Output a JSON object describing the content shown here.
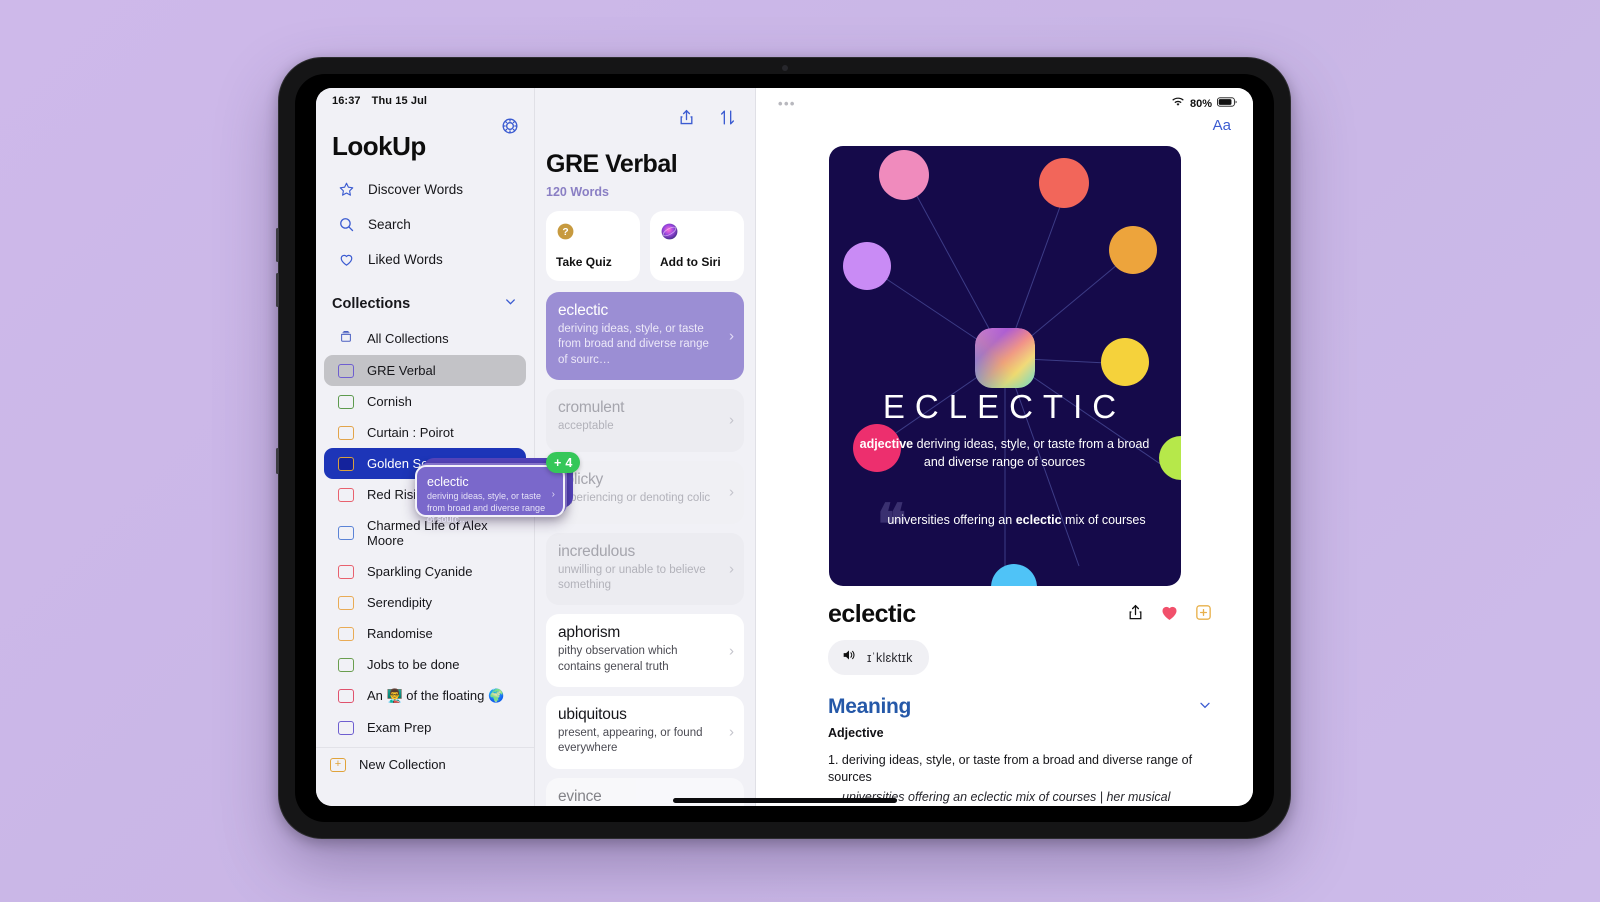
{
  "status_bar": {
    "time": "16:37",
    "date": "Thu 15 Jul",
    "battery": "80%",
    "wifi_icon": "wifi-icon",
    "battery_icon": "battery-icon"
  },
  "sidebar": {
    "app_title": "LookUp",
    "settings_icon": "gear-icon",
    "nav": [
      {
        "label": "Discover Words",
        "icon": "star-icon"
      },
      {
        "label": "Search",
        "icon": "search-icon"
      },
      {
        "label": "Liked Words",
        "icon": "heart-icon"
      }
    ],
    "collections_header": "Collections",
    "collapse_icon": "chevron-down-icon",
    "collections": [
      {
        "label": "All Collections",
        "color": "#4a5fc1",
        "state": "none"
      },
      {
        "label": "GRE Verbal",
        "color": "#6e5ed0",
        "state": "selected"
      },
      {
        "label": "Cornish",
        "color": "#5d9a4e",
        "state": "none"
      },
      {
        "label": "Curtain : Poirot",
        "color": "#e2a44a",
        "state": "none"
      },
      {
        "label": "Golden Son",
        "color": "#14229c",
        "state": "drop-target"
      },
      {
        "label": "Red Rising",
        "color": "#e8616e",
        "state": "none"
      },
      {
        "label": "Charmed Life of Alex Moore",
        "color": "#5b83d6",
        "state": "none"
      },
      {
        "label": "Sparkling Cyanide",
        "color": "#e8616e",
        "state": "none"
      },
      {
        "label": "Serendipity",
        "color": "#e9ab55",
        "state": "none"
      },
      {
        "label": "Randomise",
        "color": "#e9ab55",
        "state": "none"
      },
      {
        "label": "Jobs to be done",
        "color": "#6a9e4f",
        "state": "none"
      },
      {
        "label": "An 👨‍🏫 of the floating 🌍",
        "color": "#e0526d",
        "state": "none"
      },
      {
        "label": "Exam Prep",
        "color": "#6e5ed0",
        "state": "none"
      }
    ],
    "new_collection": {
      "label": "New Collection",
      "icon": "plus-box-icon"
    }
  },
  "word_list": {
    "share_icon": "share-icon",
    "sort_icon": "sort-arrows-icon",
    "title": "GRE Verbal",
    "count": "120 Words",
    "quick_actions": [
      {
        "label": "Take Quiz",
        "icon": "question-mark-icon"
      },
      {
        "label": "Add to Siri",
        "icon": "siri-icon"
      }
    ],
    "words": [
      {
        "word": "eclectic",
        "definition": "deriving ideas, style, or taste from broad and diverse range of sourc…",
        "state": "active"
      },
      {
        "word": "cromulent",
        "definition": "acceptable",
        "state": "dim"
      },
      {
        "word": "colicky",
        "definition": "experiencing or denoting colic",
        "state": "dim"
      },
      {
        "word": "incredulous",
        "definition": "unwilling or unable to believe something",
        "state": "dim"
      },
      {
        "word": "aphorism",
        "definition": "pithy observation which contains general truth",
        "state": "normal"
      },
      {
        "word": "ubiquitous",
        "definition": "present, appearing, or found everywhere",
        "state": "normal"
      },
      {
        "word": "evince",
        "definition": "",
        "state": "normal"
      }
    ],
    "chevron_icon": "chevron-right-icon"
  },
  "drag": {
    "card": {
      "word": "eclectic",
      "definition": "deriving ideas, style, or taste from broad and diverse range of sourc…"
    },
    "badge_count": "4",
    "badge_plus": "+",
    "badge_color": "#35c759"
  },
  "detail": {
    "more_icon": "more-dots-icon",
    "text_size_button": "Aa",
    "hero": {
      "word": "ECLECTIC",
      "part_of_speech": "adjective",
      "definition": " deriving ideas, style, or taste from a broad and diverse range of sources",
      "example_prefix": "universities offering an ",
      "example_bold": "eclectic",
      "example_suffix": " mix of courses",
      "background": "#150a4a",
      "node_colors": [
        "#f08bbd",
        "#f2665a",
        "#c98bf5",
        "#eda43c",
        "#f5d23b",
        "#ed2f6e",
        "#b6e84a",
        "#4fc3f7"
      ]
    },
    "word": "eclectic",
    "actions": [
      {
        "icon": "share-icon",
        "name": "share-button"
      },
      {
        "icon": "heart-filled-icon",
        "name": "like-button",
        "color": "#f1506b"
      },
      {
        "icon": "add-to-collection-icon",
        "name": "add-collection-button",
        "color": "#e8b04a"
      }
    ],
    "pronunciation": {
      "speaker_icon": "speaker-icon",
      "text": "ɪˈklɛktɪk"
    },
    "meaning": {
      "title": "Meaning",
      "collapse_icon": "chevron-down-icon",
      "part_of_speech": "Adjective",
      "senses": [
        {
          "number": "1.",
          "text": "deriving ideas, style, or taste from a broad and diverse range of sources",
          "example": "universities offering an eclectic mix of courses | her musical"
        }
      ]
    }
  }
}
